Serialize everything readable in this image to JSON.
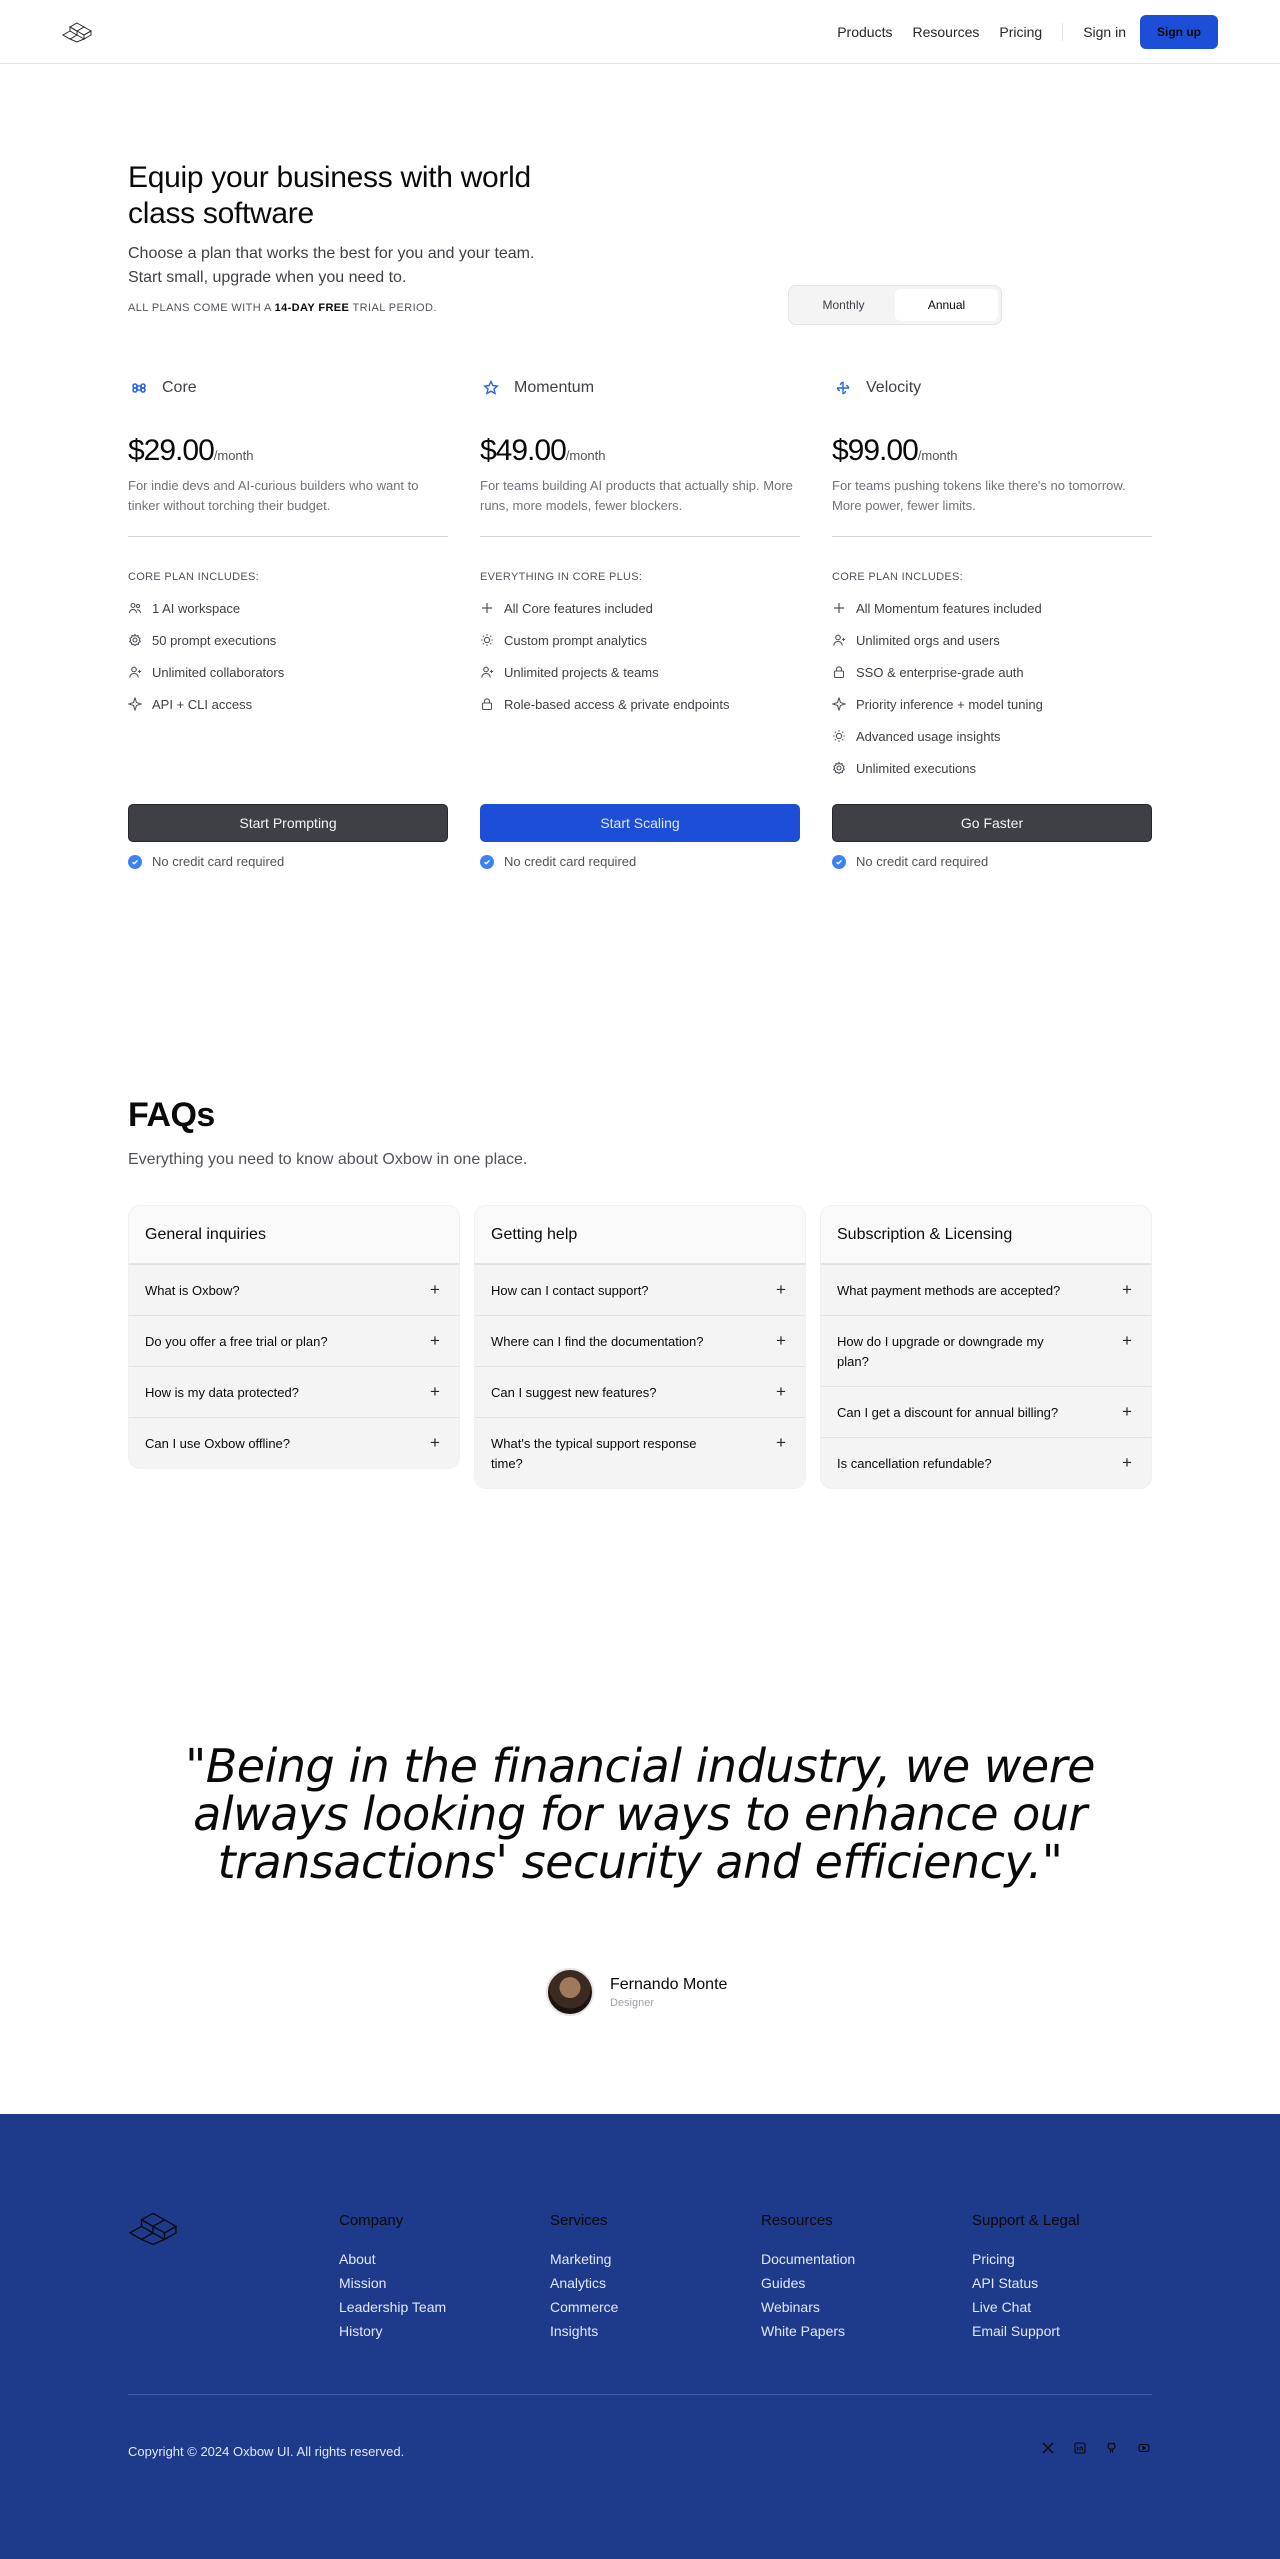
{
  "nav": {
    "links": [
      "Products",
      "Resources",
      "Pricing"
    ],
    "signin": "Sign in",
    "signup": "Sign up"
  },
  "hero": {
    "title": "Equip your business with world class software",
    "subtitle": "Choose a plan that works the best for you and your team. Start small, upgrade when you need to.",
    "trial_prefix": "All plans come with a",
    "trial_bold": "14-day free",
    "trial_suffix": "trial period."
  },
  "billing_toggle": {
    "monthly": "Monthly",
    "annual": "Annual",
    "selected": "Annual"
  },
  "plans": [
    {
      "name": "Core",
      "icon": "command-icon",
      "price": "$29.00",
      "period": "/month",
      "description": "For indie devs and AI-curious builders who want to tinker without torching their budget.",
      "includes_title": "Core plan includes:",
      "features": [
        {
          "icon": "users-icon",
          "text": "1 AI workspace"
        },
        {
          "icon": "cog-icon",
          "text": "50 prompt executions"
        },
        {
          "icon": "user-icon",
          "text": "Unlimited collaborators"
        },
        {
          "icon": "code-icon",
          "text": "API + CLI access"
        }
      ],
      "cta": "Start Prompting",
      "primary": false,
      "note": "No credit card required"
    },
    {
      "name": "Momentum",
      "icon": "star-icon",
      "price": "$49.00",
      "period": "/month",
      "description": "For teams building AI products that actually ship. More runs, more models, fewer blockers.",
      "includes_title": "Everything in Core plus:",
      "features": [
        {
          "icon": "plus-icon",
          "text": "All Core features included"
        },
        {
          "icon": "bulb-icon",
          "text": "Custom prompt analytics"
        },
        {
          "icon": "user-icon",
          "text": "Unlimited projects & teams"
        },
        {
          "icon": "lock-icon",
          "text": "Role-based access & private endpoints"
        }
      ],
      "cta": "Start Scaling",
      "primary": true,
      "note": "No credit card required"
    },
    {
      "name": "Velocity",
      "icon": "pinwheel-icon",
      "price": "$99.00",
      "period": "/month",
      "description": "For teams pushing tokens like there's no tomorrow. More power, fewer limits.",
      "includes_title": "Core plan includes:",
      "features": [
        {
          "icon": "plus-icon",
          "text": "All Momentum features included"
        },
        {
          "icon": "user-icon",
          "text": "Unlimited orgs and users"
        },
        {
          "icon": "lock-icon",
          "text": "SSO & enterprise-grade auth"
        },
        {
          "icon": "code-icon",
          "text": "Priority inference + model tuning"
        },
        {
          "icon": "bulb-icon",
          "text": "Advanced usage insights"
        },
        {
          "icon": "cog-icon",
          "text": "Unlimited executions"
        }
      ],
      "cta": "Go Faster",
      "primary": false,
      "note": "No credit card required"
    }
  ],
  "faq": {
    "title": "FAQs",
    "subtitle": "Everything you need to know about Oxbow in one place.",
    "groups": [
      {
        "title": "General inquiries",
        "questions": [
          "What is Oxbow?",
          "Do you offer a free trial or plan?",
          "How is my data protected?",
          "Can I use Oxbow offline?"
        ]
      },
      {
        "title": "Getting help",
        "questions": [
          "How can I contact support?",
          "Where can I find the documentation?",
          "Can I suggest new features?",
          "What's the typical support response time?"
        ]
      },
      {
        "title": "Subscription & Licensing",
        "questions": [
          "What payment methods are accepted?",
          "How do I upgrade or downgrade my plan?",
          "Can I get a discount for annual billing?",
          "Is cancellation refundable?"
        ]
      }
    ]
  },
  "testimonial": {
    "quote": "\"Being in the financial industry, we were always looking for ways to enhance our transactions' security and efficiency.\"",
    "name": "Fernando Monte",
    "role": "Designer"
  },
  "footer": {
    "columns": [
      {
        "title": "Company",
        "links": [
          "About",
          "Mission",
          "Leadership Team",
          "History"
        ]
      },
      {
        "title": "Services",
        "links": [
          "Marketing",
          "Analytics",
          "Commerce",
          "Insights"
        ]
      },
      {
        "title": "Resources",
        "links": [
          "Documentation",
          "Guides",
          "Webinars",
          "White Papers"
        ]
      },
      {
        "title": "Support & Legal",
        "links": [
          "Pricing",
          "API Status",
          "Live Chat",
          "Email Support"
        ]
      }
    ],
    "copyright": "Copyright © 2024 Oxbow UI. All rights reserved.",
    "socials": [
      "x-icon",
      "linkedin-icon",
      "github-icon",
      "youtube-icon"
    ]
  },
  "colors": {
    "accent": "#1d4ed8",
    "footer_bg": "#1e3a8a",
    "check": "#3b82f6"
  }
}
